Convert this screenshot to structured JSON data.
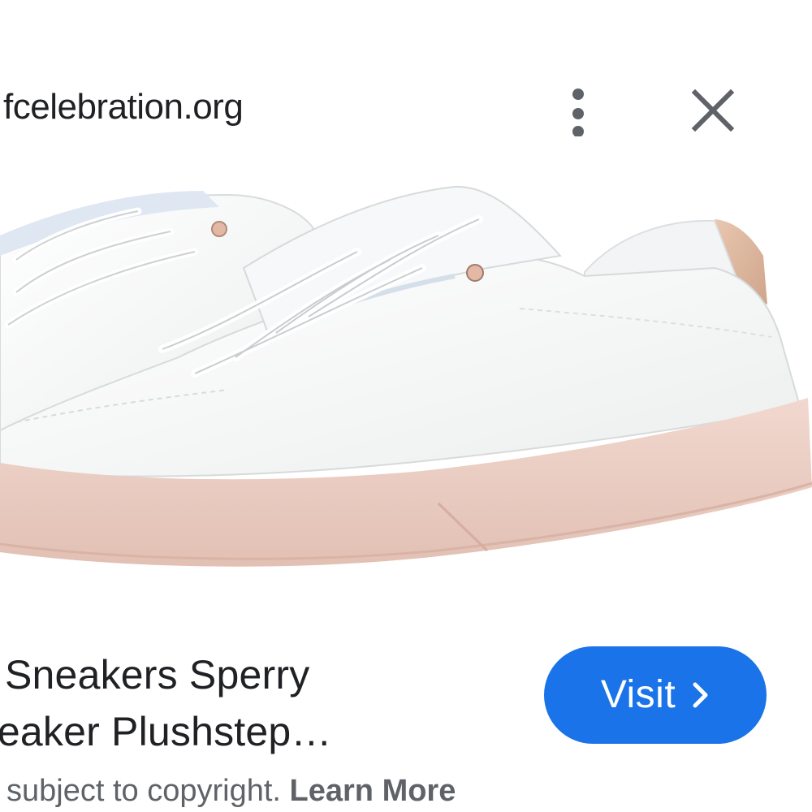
{
  "header": {
    "domain": "fcelebration.org",
    "more_icon": "more-vert-icon",
    "close_icon": "close-icon"
  },
  "image": {
    "subject": "white leather sneakers with pink sole"
  },
  "title": {
    "line1": "Sneakers Sperry",
    "line2": "reaker Plushstep…"
  },
  "visit_button": {
    "label": "Visit",
    "icon": "chevron-right-icon",
    "color": "#1a73e8"
  },
  "footer": {
    "copyright_text": "subject to copyright.",
    "learn_more": "Learn More"
  },
  "colors": {
    "text": "#202124",
    "secondary_text": "#5f6368",
    "icon": "#5f6368"
  }
}
